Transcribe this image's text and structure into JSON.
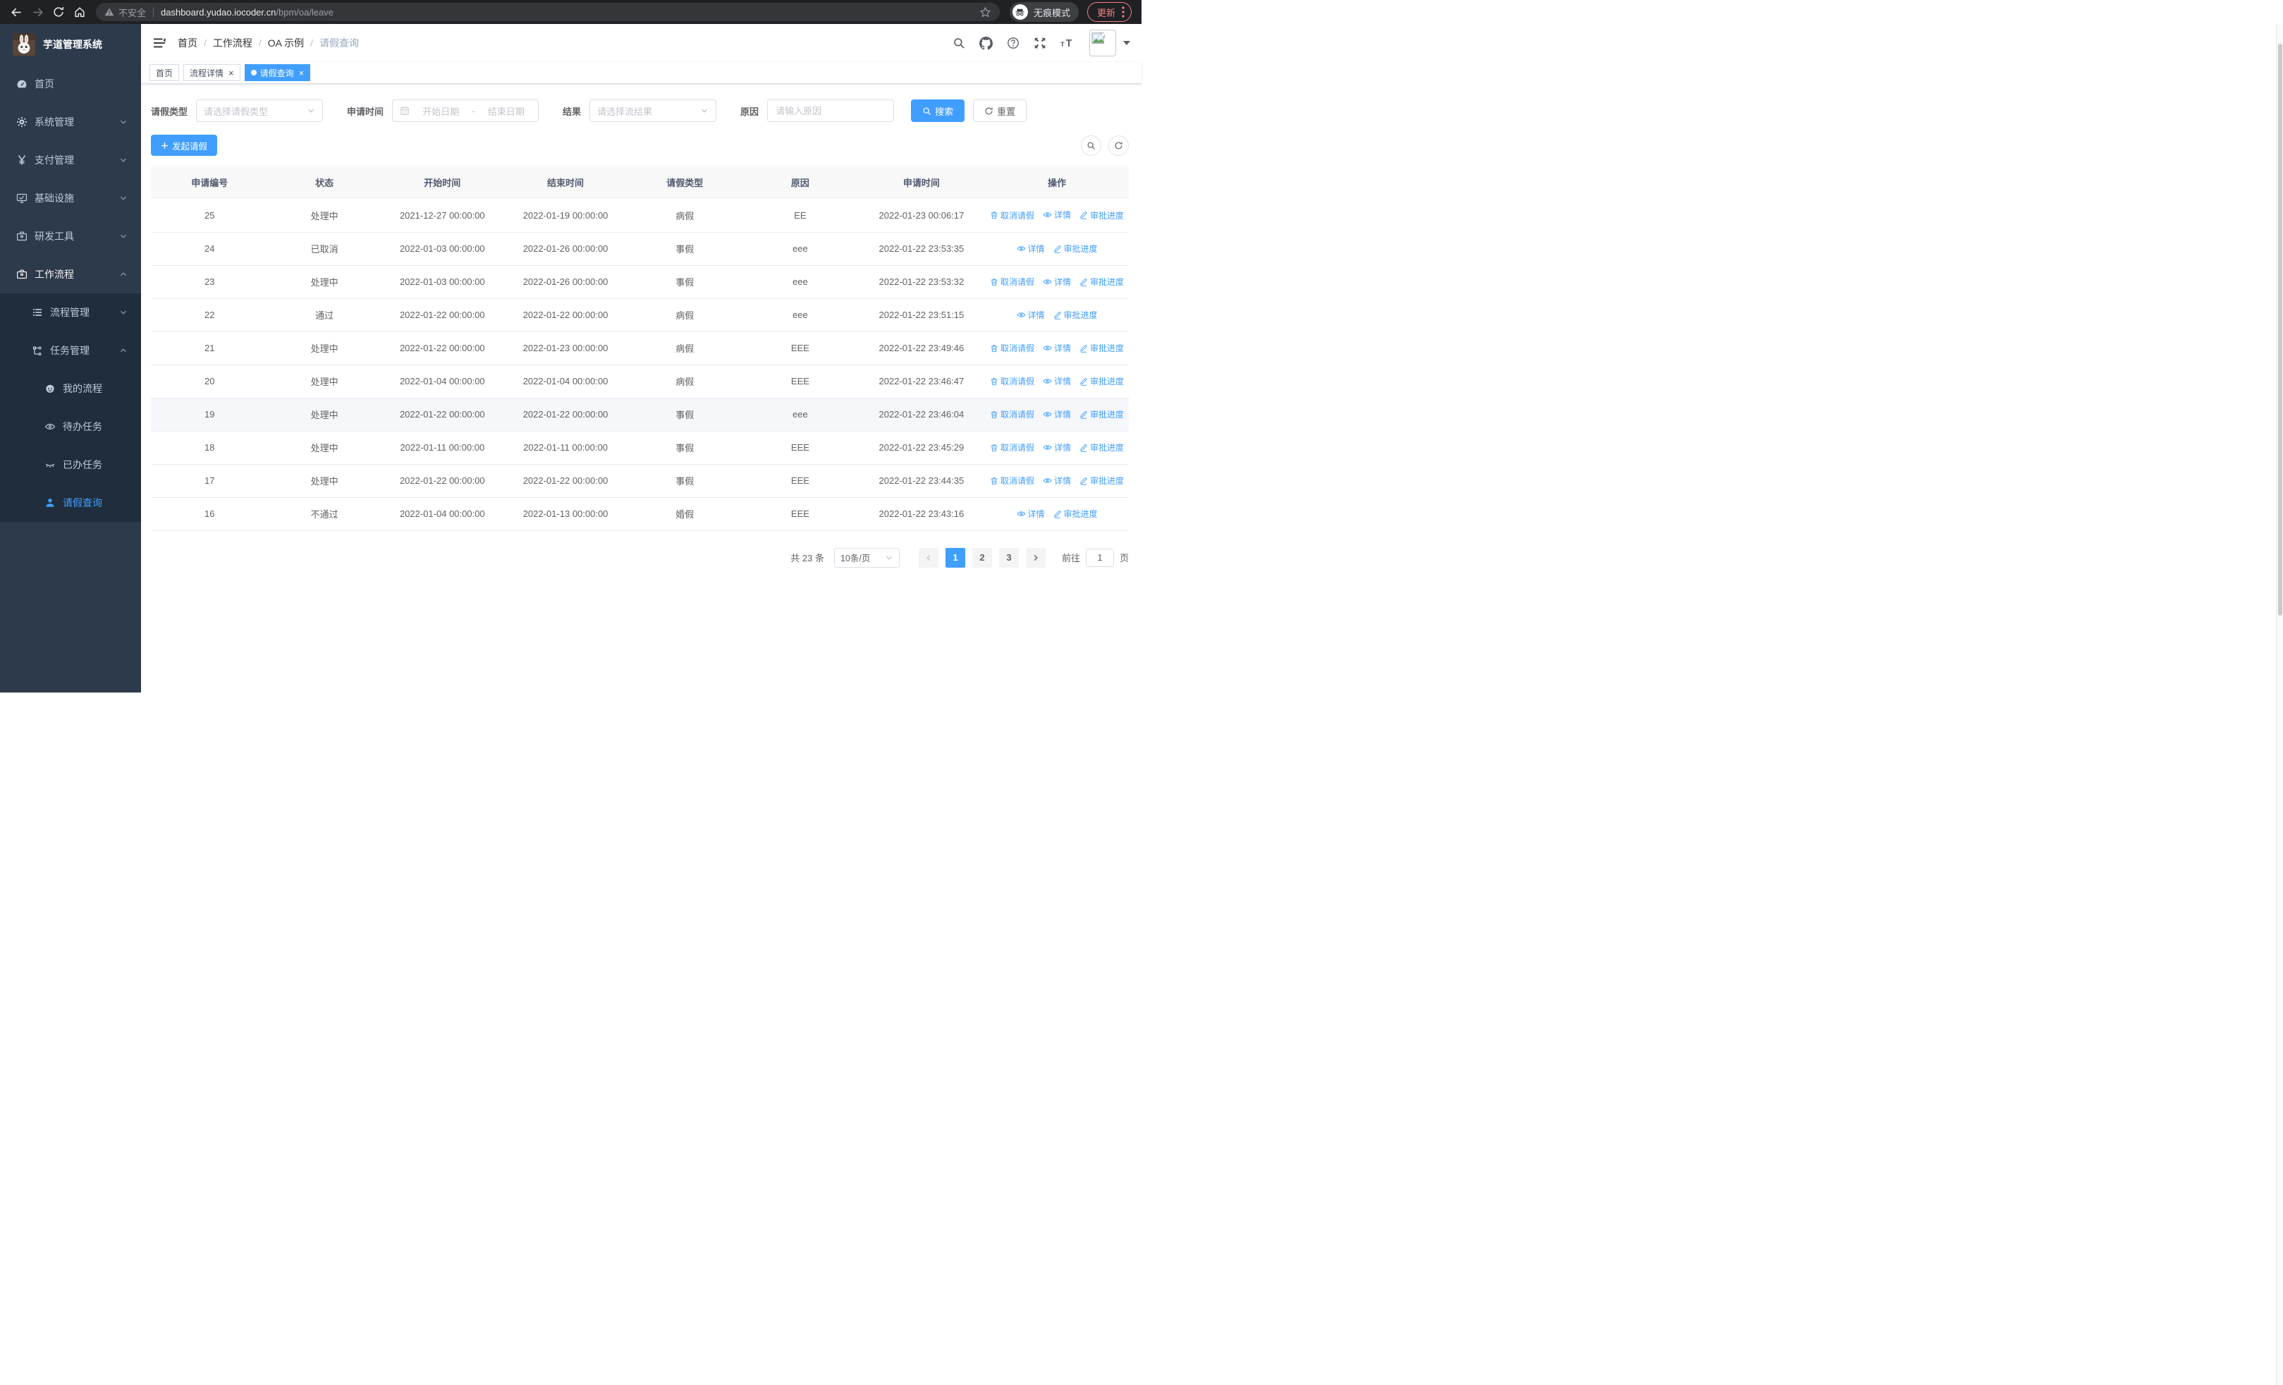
{
  "colors": {
    "accent": "#409eff",
    "sidebar_bg": "#2d3a4b",
    "submenu_bg": "#1f2d3d",
    "update_accent": "#f08080"
  },
  "browser": {
    "security_warning": "不安全",
    "url_host": "dashboard.yudao.iocoder.cn",
    "url_path": "/bpm/oa/leave",
    "incognito_label": "无痕模式",
    "update_label": "更新"
  },
  "sidebar": {
    "app_title": "芋道管理系统",
    "items": [
      {
        "key": "home",
        "label": "首页",
        "icon": "dashboard-icon",
        "level": 1
      },
      {
        "key": "system",
        "label": "系统管理",
        "icon": "gear-icon",
        "level": 1,
        "chevron": "down"
      },
      {
        "key": "payment",
        "label": "支付管理",
        "icon": "yen-icon",
        "level": 1,
        "chevron": "down"
      },
      {
        "key": "infrastructure",
        "label": "基础设施",
        "icon": "monitor-icon",
        "level": 1,
        "chevron": "down"
      },
      {
        "key": "devtools",
        "label": "研发工具",
        "icon": "toolbox-icon",
        "level": 1,
        "chevron": "down"
      },
      {
        "key": "workflow",
        "label": "工作流程",
        "icon": "toolbox-icon",
        "level": 1,
        "chevron": "up",
        "expanded": true
      },
      {
        "key": "process-mgmt",
        "label": "流程管理",
        "icon": "list-icon",
        "level": 2,
        "chevron": "down",
        "sub": true
      },
      {
        "key": "task-mgmt",
        "label": "任务管理",
        "icon": "tree-icon",
        "level": 2,
        "chevron": "up",
        "sub": true
      },
      {
        "key": "my-process",
        "label": "我的流程",
        "icon": "face-icon",
        "level": 3,
        "sub": true
      },
      {
        "key": "todo-tasks",
        "label": "待办任务",
        "icon": "eye-open-icon",
        "level": 3,
        "sub": true
      },
      {
        "key": "done-tasks",
        "label": "已办任务",
        "icon": "eye-closed-icon",
        "level": 3,
        "sub": true
      },
      {
        "key": "leave-query",
        "label": "请假查询",
        "icon": "user-icon",
        "level": 3,
        "sub": true,
        "active": true
      }
    ]
  },
  "breadcrumb_separator": "/",
  "breadcrumb": [
    {
      "label": "首页"
    },
    {
      "label": "工作流程"
    },
    {
      "label": "OA 示例"
    },
    {
      "label": "请假查询",
      "muted": true
    }
  ],
  "tabs": [
    {
      "key": "home",
      "label": "首页"
    },
    {
      "key": "process-detail",
      "label": "流程详情",
      "closable": true
    },
    {
      "key": "leave-query",
      "label": "请假查询",
      "closable": true,
      "active": true
    }
  ],
  "filters": {
    "leave_type": {
      "label": "请假类型",
      "placeholder": "请选择请假类型"
    },
    "apply_time": {
      "label": "申请时间",
      "start_placeholder": "开始日期",
      "separator": "-",
      "end_placeholder": "结束日期"
    },
    "result": {
      "label": "结果",
      "placeholder": "请选择流结果"
    },
    "reason": {
      "label": "原因",
      "placeholder": "请输入原因"
    },
    "search_label": "搜索",
    "reset_label": "重置"
  },
  "toolbar": {
    "create_label": "发起请假"
  },
  "table": {
    "headers": [
      "申请编号",
      "状态",
      "开始时间",
      "结束时间",
      "请假类型",
      "原因",
      "申请时间",
      "操作"
    ],
    "action_defs": {
      "cancel": {
        "label": "取消请假",
        "icon": "trash-icon"
      },
      "detail": {
        "label": "详情",
        "icon": "eye-icon"
      },
      "progress": {
        "label": "审批进度",
        "icon": "edit-icon"
      }
    },
    "rows": [
      {
        "id": "25",
        "status": "处理中",
        "start_time": "2021-12-27 00:00:00",
        "end_time": "2022-01-19 00:00:00",
        "leave_type": "病假",
        "reason": "EE",
        "apply_time": "2022-01-23 00:06:17",
        "actions": [
          "cancel",
          "detail",
          "progress"
        ]
      },
      {
        "id": "24",
        "status": "已取消",
        "start_time": "2022-01-03 00:00:00",
        "end_time": "2022-01-26 00:00:00",
        "leave_type": "事假",
        "reason": "eee",
        "apply_time": "2022-01-22 23:53:35",
        "actions": [
          "detail",
          "progress"
        ]
      },
      {
        "id": "23",
        "status": "处理中",
        "start_time": "2022-01-03 00:00:00",
        "end_time": "2022-01-26 00:00:00",
        "leave_type": "事假",
        "reason": "eee",
        "apply_time": "2022-01-22 23:53:32",
        "actions": [
          "cancel",
          "detail",
          "progress"
        ]
      },
      {
        "id": "22",
        "status": "通过",
        "start_time": "2022-01-22 00:00:00",
        "end_time": "2022-01-22 00:00:00",
        "leave_type": "病假",
        "reason": "eee",
        "apply_time": "2022-01-22 23:51:15",
        "actions": [
          "detail",
          "progress"
        ]
      },
      {
        "id": "21",
        "status": "处理中",
        "start_time": "2022-01-22 00:00:00",
        "end_time": "2022-01-23 00:00:00",
        "leave_type": "病假",
        "reason": "EEE",
        "apply_time": "2022-01-22 23:49:46",
        "actions": [
          "cancel",
          "detail",
          "progress"
        ]
      },
      {
        "id": "20",
        "status": "处理中",
        "start_time": "2022-01-04 00:00:00",
        "end_time": "2022-01-04 00:00:00",
        "leave_type": "病假",
        "reason": "EEE",
        "apply_time": "2022-01-22 23:46:47",
        "actions": [
          "cancel",
          "detail",
          "progress"
        ]
      },
      {
        "id": "19",
        "status": "处理中",
        "start_time": "2022-01-22 00:00:00",
        "end_time": "2022-01-22 00:00:00",
        "leave_type": "事假",
        "reason": "eee",
        "apply_time": "2022-01-22 23:46:04",
        "actions": [
          "cancel",
          "detail",
          "progress"
        ],
        "highlight": true
      },
      {
        "id": "18",
        "status": "处理中",
        "start_time": "2022-01-11 00:00:00",
        "end_time": "2022-01-11 00:00:00",
        "leave_type": "事假",
        "reason": "EEE",
        "apply_time": "2022-01-22 23:45:29",
        "actions": [
          "cancel",
          "detail",
          "progress"
        ]
      },
      {
        "id": "17",
        "status": "处理中",
        "start_time": "2022-01-22 00:00:00",
        "end_time": "2022-01-22 00:00:00",
        "leave_type": "事假",
        "reason": "EEE",
        "apply_time": "2022-01-22 23:44:35",
        "actions": [
          "cancel",
          "detail",
          "progress"
        ]
      },
      {
        "id": "16",
        "status": "不通过",
        "start_time": "2022-01-04 00:00:00",
        "end_time": "2022-01-13 00:00:00",
        "leave_type": "婚假",
        "reason": "EEE",
        "apply_time": "2022-01-22 23:43:16",
        "actions": [
          "detail",
          "progress"
        ]
      }
    ]
  },
  "pagination": {
    "total_label": "共 23 条",
    "page_size": "10条/页",
    "pages": [
      "1",
      "2",
      "3"
    ],
    "active_page": "1",
    "goto_label": "前往",
    "goto_value": "1",
    "unit_label": "页"
  }
}
